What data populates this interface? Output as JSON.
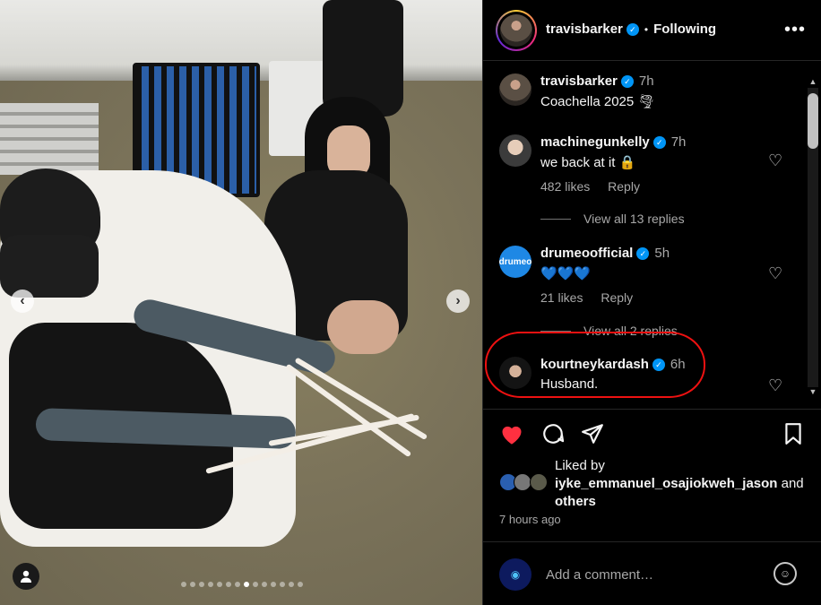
{
  "post": {
    "carousel": {
      "dot_count": 14,
      "active_index": 7
    },
    "header": {
      "username": "travisbarker",
      "separator": "•",
      "follow_status": "Following",
      "more_icon": "more-horizontal-icon"
    },
    "caption": {
      "username": "travisbarker",
      "time": "7h",
      "text": "Coachella 2025 🌪"
    },
    "comments": [
      {
        "username": "machinegunkelly",
        "time": "7h",
        "text": "we back at it 🔒",
        "likes": "482 likes",
        "reply": "Reply",
        "view_replies": "View all 13 replies"
      },
      {
        "username": "drumeoofficial",
        "time": "5h",
        "text": "💙💙💙",
        "likes": "21 likes",
        "reply": "Reply",
        "view_replies": "View all 2 replies"
      },
      {
        "username": "kourtneykardash",
        "time": "6h",
        "text": "Husband."
      }
    ],
    "drumeo_avatar_text": "drumeo",
    "liked_by": {
      "prefix": "Liked by",
      "user": "iyke_emmanuel_osajiokweh_jason",
      "and": "and",
      "others": "others"
    },
    "time_ago": "7 hours ago",
    "add_comment_placeholder": "Add a comment…",
    "colors": {
      "like_red": "#ff3040",
      "verified_blue": "#0095f6",
      "highlight_red": "#e11111"
    }
  }
}
